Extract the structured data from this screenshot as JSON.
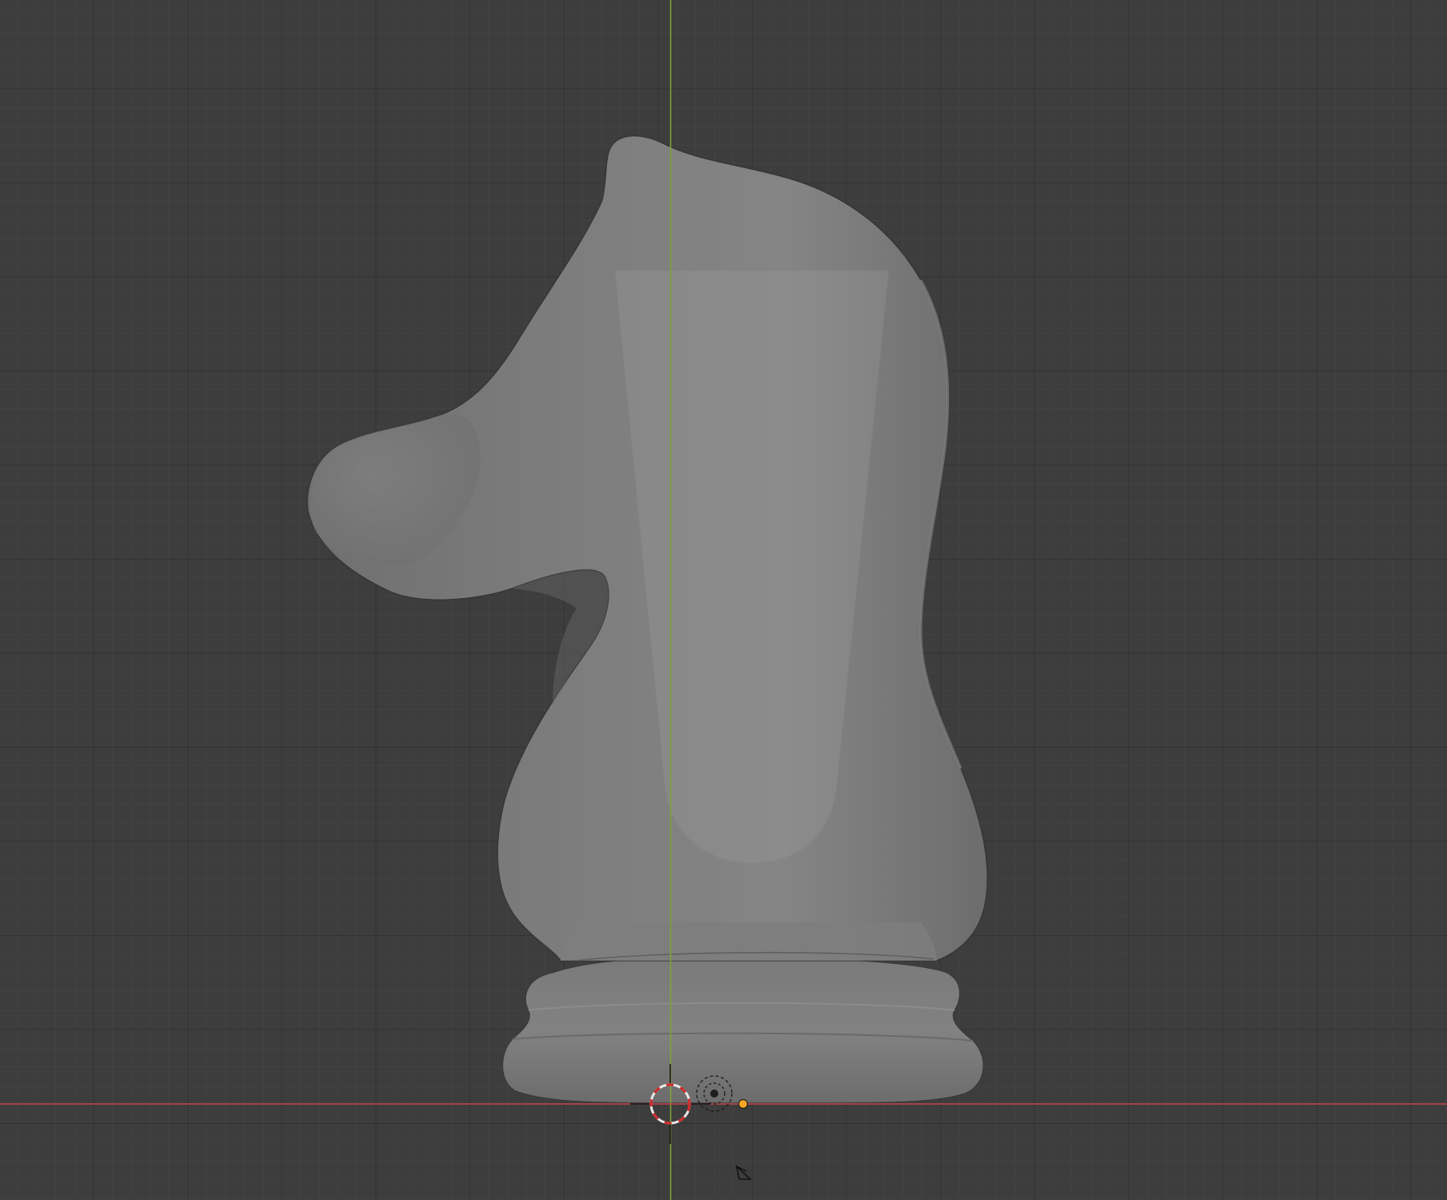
{
  "viewport": {
    "background_color": "#3d3d3d",
    "grid_minor_color": "#454545",
    "grid_major_color": "#2f2f2f",
    "axis_x_color": "#c8434f",
    "axis_z_color": "#7fa23a"
  },
  "scene": {
    "object_name": "Knight",
    "object_kind": "mesh-chess-knight",
    "body_color": "#7c7c7c",
    "body_shade_color": "#8a8a8a",
    "body_edge_color": "#3a3a3a",
    "reference_plane_color": "#9a9a9a",
    "origin_marker_color": "#f5a623",
    "cursor_color_1": "#e8e8e8",
    "cursor_color_2": "#d02a2a"
  },
  "overlays": {
    "camera_icon": "camera-icon",
    "light_icon": "sun-light-icon",
    "cursor_icon": "3d-cursor-icon"
  }
}
